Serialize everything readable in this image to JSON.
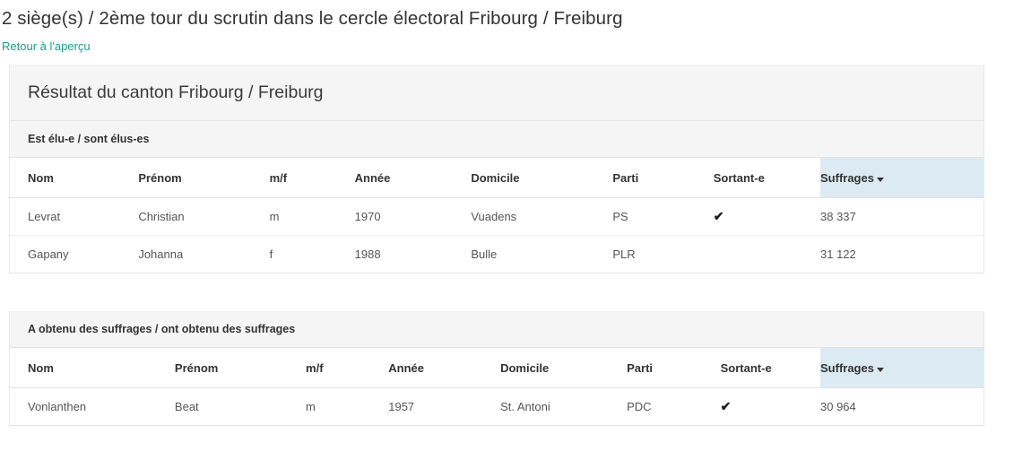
{
  "page": {
    "title": "2 siège(s) / 2ème tour du scrutin dans le cercle électoral Fribourg / Freiburg",
    "back_link": "Retour à l'aperçu"
  },
  "card": {
    "header_title": "Résultat du canton Fribourg / Freiburg"
  },
  "colors": {
    "link": "#1e9c8b",
    "header_bg": "#f5f5f5",
    "sorted_column_bg": "#dceaf4",
    "border": "#e2e2e2",
    "text": "#333333",
    "cell_text": "#555555"
  },
  "icons": {
    "sort_desc": "sort-descending-caret",
    "elected_incumbent": "check-mark"
  },
  "columns": [
    "Nom",
    "Prénom",
    "m/f",
    "Année",
    "Domicile",
    "Parti",
    "Sortant-e",
    "Suffrages"
  ],
  "sections": [
    {
      "title": "Est élu-e / sont élus-es",
      "sorted_column": "Suffrages",
      "sort_direction": "desc",
      "rows": [
        {
          "nom": "Levrat",
          "prenom": "Christian",
          "mf": "m",
          "annee": "1970",
          "domicile": "Vuadens",
          "parti": "PS",
          "sortant": "✔",
          "suffrages": "38 337"
        },
        {
          "nom": "Gapany",
          "prenom": "Johanna",
          "mf": "f",
          "annee": "1988",
          "domicile": "Bulle",
          "parti": "PLR",
          "sortant": "",
          "suffrages": "31 122"
        }
      ]
    },
    {
      "title": "A obtenu des suffrages / ont obtenu des suffrages",
      "sorted_column": "Suffrages",
      "sort_direction": "desc",
      "rows": [
        {
          "nom": "Vonlanthen",
          "prenom": "Beat",
          "mf": "m",
          "annee": "1957",
          "domicile": "St. Antoni",
          "parti": "PDC",
          "sortant": "✔",
          "suffrages": "30 964"
        }
      ]
    }
  ]
}
